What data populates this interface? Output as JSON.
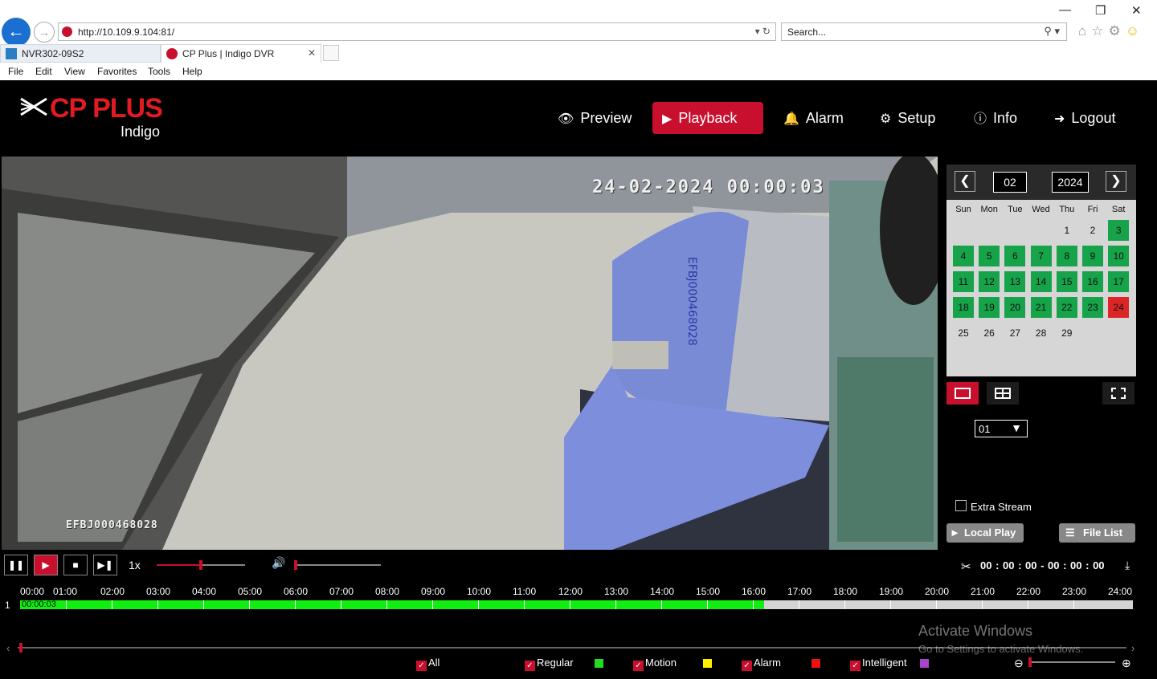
{
  "browser": {
    "url": "http://10.109.9.104:81/",
    "search_placeholder": "Search...",
    "tabs": [
      {
        "label": "NVR302-09S2"
      },
      {
        "label": "CP Plus | Indigo DVR"
      }
    ],
    "menu": [
      "File",
      "Edit",
      "View",
      "Favorites",
      "Tools",
      "Help"
    ]
  },
  "app": {
    "brand": "CP PLUS",
    "product": "Indigo",
    "nav": [
      {
        "label": "Preview",
        "icon": "eye-icon"
      },
      {
        "label": "Playback",
        "icon": "play-circle-icon",
        "active": true
      },
      {
        "label": "Alarm",
        "icon": "bell-icon"
      },
      {
        "label": "Setup",
        "icon": "gear-icon"
      },
      {
        "label": "Info",
        "icon": "info-icon"
      },
      {
        "label": "Logout",
        "icon": "logout-icon"
      }
    ],
    "accent_color": "#c8102e"
  },
  "video": {
    "timestamp": "24-02-2024 00:00:03",
    "camera_label": "EFBJ000468028",
    "atm_handwritten": "EFBJ000468028"
  },
  "calendar": {
    "month": "02",
    "year": "2024",
    "weekdays": [
      "Sun",
      "Mon",
      "Tue",
      "Wed",
      "Thu",
      "Fri",
      "Sat"
    ],
    "first_weekday_index": 4,
    "days_in_month": 29,
    "record_days": [
      3,
      4,
      5,
      6,
      7,
      8,
      9,
      10,
      11,
      12,
      13,
      14,
      15,
      16,
      17,
      18,
      19,
      20,
      21,
      22,
      23
    ],
    "alarm_days": [
      24
    ],
    "record_color": "#16a34a",
    "alarm_color": "#dc2626"
  },
  "layout_controls": {
    "channel_value": "01",
    "extra_stream_label": "Extra Stream",
    "extra_stream_checked": false,
    "local_play_label": "Local Play",
    "file_list_label": "File List"
  },
  "playback": {
    "speed_label": "1x",
    "progress_fraction": 0.5,
    "volume_fraction": 0.0,
    "clip_range": "00 : 00 : 00 - 00 : 00 : 00"
  },
  "timeline": {
    "hours": [
      "00:00",
      "01:00",
      "02:00",
      "03:00",
      "04:00",
      "05:00",
      "06:00",
      "07:00",
      "08:00",
      "09:00",
      "10:00",
      "11:00",
      "12:00",
      "13:00",
      "14:00",
      "15:00",
      "16:00",
      "17:00",
      "18:00",
      "19:00",
      "20:00",
      "21:00",
      "22:00",
      "23:00",
      "24:00"
    ],
    "channel": "1",
    "current_time": "00:00:03",
    "recorded_until_hour": 16,
    "legend": [
      {
        "label": "All",
        "color": ""
      },
      {
        "label": "Regular",
        "color": "#22dd22"
      },
      {
        "label": "Motion",
        "color": "#ffee00"
      },
      {
        "label": "Alarm",
        "color": "#ee1111"
      },
      {
        "label": "Intelligent",
        "color": "#aa44cc"
      }
    ]
  },
  "watermark": {
    "title": "Activate Windows",
    "subtitle": "Go to Settings to activate Windows."
  }
}
